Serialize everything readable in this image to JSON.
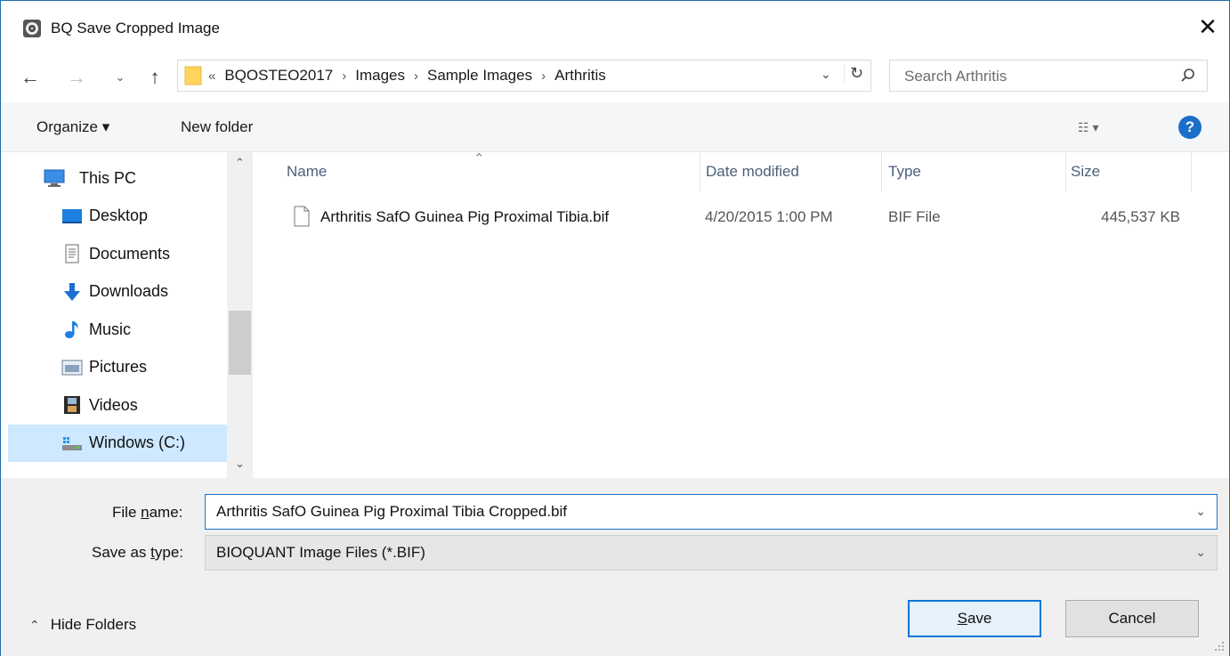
{
  "window": {
    "title": "BQ Save Cropped Image",
    "close_glyph": "✕"
  },
  "nav": {
    "back_glyph": "←",
    "forward_glyph": "→",
    "recent_glyph": "⌄",
    "up_glyph": "↑"
  },
  "address": {
    "overflow_glyph": "«",
    "crumbs": [
      "BQOSTEO2017",
      "Images",
      "Sample Images",
      "Arthritis"
    ],
    "separator": "›",
    "dropdown_glyph": "⌄",
    "refresh_glyph": "↻"
  },
  "search": {
    "placeholder": "Search Arthritis",
    "icon": "search-icon"
  },
  "toolbar": {
    "organize_label": "Organize ▾",
    "new_folder_label": "New folder",
    "view_label": "☷ ▾",
    "help_label": "?"
  },
  "sidebar": {
    "items": [
      {
        "label": "This PC",
        "icon": "computer-icon"
      },
      {
        "label": "Desktop",
        "icon": "desktop-icon"
      },
      {
        "label": "Documents",
        "icon": "documents-icon"
      },
      {
        "label": "Downloads",
        "icon": "downloads-icon"
      },
      {
        "label": "Music",
        "icon": "music-icon"
      },
      {
        "label": "Pictures",
        "icon": "pictures-icon"
      },
      {
        "label": "Videos",
        "icon": "videos-icon"
      },
      {
        "label": "Windows (C:)",
        "icon": "drive-icon",
        "selected": true
      }
    ],
    "scroll_up": "⌃",
    "scroll_down": "⌄"
  },
  "filelist": {
    "columns": [
      "Name",
      "Date modified",
      "Type",
      "Size"
    ],
    "sort_glyph": "⌃",
    "rows": [
      {
        "name": "Arthritis SafO Guinea Pig Proximal Tibia.bif",
        "date": "4/20/2015 1:00 PM",
        "type": "BIF File",
        "size": "445,537 KB"
      }
    ]
  },
  "form": {
    "file_name_label_pre": "File ",
    "file_name_label_u": "n",
    "file_name_label_post": "ame:",
    "file_name_value": "Arthritis SafO Guinea Pig Proximal Tibia Cropped.bif",
    "save_type_label_pre": "Save as ",
    "save_type_label_u": "t",
    "save_type_label_post": "ype:",
    "save_type_value": "BIOQUANT Image Files (*.BIF)",
    "combo_glyph": "⌄",
    "hide_folders_glyph": "⌃",
    "hide_folders_label": "Hide Folders",
    "save_label_u": "S",
    "save_label_rest": "ave",
    "cancel_label": "Cancel"
  },
  "colors": {
    "accent": "#0078d7",
    "selected_bg": "#cde8ff",
    "help_bg": "#1a6fc8"
  }
}
